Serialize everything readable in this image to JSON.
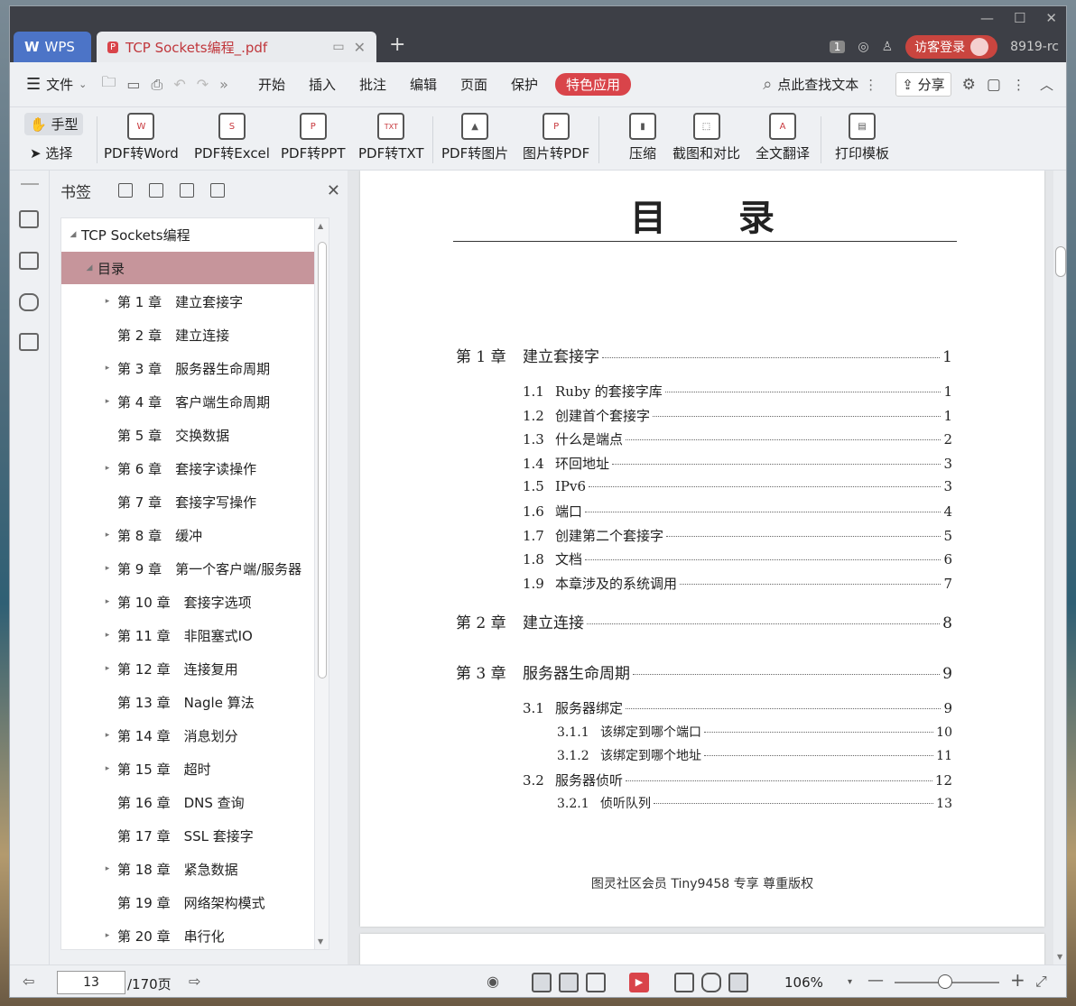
{
  "titlebar": {
    "wps_tab": "WPS",
    "doc_tab": "TCP Sockets编程_.pdf",
    "page_badge": "1",
    "login": "访客登录",
    "account": "8919-rc"
  },
  "menubar": {
    "file": "文件",
    "items": [
      "开始",
      "插入",
      "批注",
      "编辑",
      "页面",
      "保护"
    ],
    "feature": "特色应用",
    "search": "点此查找文本",
    "share": "分享"
  },
  "toolbar": {
    "hand": "手型",
    "select": "选择",
    "tools": [
      {
        "label": "PDF转Word",
        "ic": "W"
      },
      {
        "label": "PDF转Excel",
        "ic": "S"
      },
      {
        "label": "PDF转PPT",
        "ic": "P"
      },
      {
        "label": "PDF转TXT",
        "ic": "TXT"
      },
      {
        "label": "PDF转图片",
        "ic": "▲"
      },
      {
        "label": "图片转PDF",
        "ic": "P"
      },
      {
        "label": "压缩",
        "ic": "▮"
      },
      {
        "label": "截图和对比",
        "ic": "⬚"
      },
      {
        "label": "全文翻译",
        "ic": "A"
      },
      {
        "label": "打印模板",
        "ic": "▤"
      }
    ]
  },
  "bookmarks": {
    "title": "书签",
    "root": "TCP Sockets编程",
    "selected": "目录",
    "items": [
      {
        "label": "第 1 章　建立套接字",
        "expand": true
      },
      {
        "label": "第 2 章　建立连接",
        "expand": false
      },
      {
        "label": "第 3 章　服务器生命周期",
        "expand": true
      },
      {
        "label": "第 4 章　客户端生命周期",
        "expand": true
      },
      {
        "label": "第 5 章　交换数据",
        "expand": false
      },
      {
        "label": "第 6 章　套接字读操作",
        "expand": true
      },
      {
        "label": "第 7 章　套接字写操作",
        "expand": false
      },
      {
        "label": "第 8 章　缓冲",
        "expand": true
      },
      {
        "label": "第 9 章　第一个客户端/服务器",
        "expand": true
      },
      {
        "label": "第 10 章　套接字选项",
        "expand": true
      },
      {
        "label": "第 11 章　非阻塞式IO",
        "expand": true
      },
      {
        "label": "第 12 章　连接复用",
        "expand": true
      },
      {
        "label": "第 13 章　Nagle 算法",
        "expand": false
      },
      {
        "label": "第 14 章　消息划分",
        "expand": true
      },
      {
        "label": "第 15 章　超时",
        "expand": true
      },
      {
        "label": "第 16 章　DNS 查询",
        "expand": false
      },
      {
        "label": "第 17 章　SSL 套接字",
        "expand": false
      },
      {
        "label": "第 18 章　紧急数据",
        "expand": true
      },
      {
        "label": "第 19 章　网络架构模式",
        "expand": false
      },
      {
        "label": "第 20 章　串行化",
        "expand": true
      }
    ]
  },
  "document": {
    "title": "目录",
    "watermark": "图灵社区会员 Tiny9458 专享 尊重版权",
    "toc": [
      {
        "level": "ch",
        "num": "第 1 章",
        "text": "建立套接字",
        "page": "1"
      },
      {
        "level": "sec",
        "num": "1.1",
        "text": "Ruby 的套接字库",
        "page": "1"
      },
      {
        "level": "sec",
        "num": "1.2",
        "text": "创建首个套接字",
        "page": "1"
      },
      {
        "level": "sec",
        "num": "1.3",
        "text": "什么是端点",
        "page": "2"
      },
      {
        "level": "sec",
        "num": "1.4",
        "text": "环回地址",
        "page": "3"
      },
      {
        "level": "sec",
        "num": "1.5",
        "text": "IPv6",
        "page": "3"
      },
      {
        "level": "sec",
        "num": "1.6",
        "text": "端口",
        "page": "4"
      },
      {
        "level": "sec",
        "num": "1.7",
        "text": "创建第二个套接字",
        "page": "5"
      },
      {
        "level": "sec",
        "num": "1.8",
        "text": "文档",
        "page": "6"
      },
      {
        "level": "sec",
        "num": "1.9",
        "text": "本章涉及的系统调用",
        "page": "7"
      },
      {
        "level": "ch",
        "num": "第 2 章",
        "text": "建立连接",
        "page": "8"
      },
      {
        "level": "ch",
        "num": "第 3 章",
        "text": "服务器生命周期",
        "page": "9"
      },
      {
        "level": "sec",
        "num": "3.1",
        "text": "服务器绑定",
        "page": "9"
      },
      {
        "level": "sub",
        "num": "3.1.1",
        "text": "该绑定到哪个端口",
        "page": "10"
      },
      {
        "level": "sub",
        "num": "3.1.2",
        "text": "该绑定到哪个地址",
        "page": "11"
      },
      {
        "level": "sec",
        "num": "3.2",
        "text": "服务器侦听",
        "page": "12"
      },
      {
        "level": "sub",
        "num": "3.2.1",
        "text": "侦听队列",
        "page": "13"
      }
    ]
  },
  "statusbar": {
    "current_page": "13",
    "total_pages": "/170页",
    "zoom": "106%"
  }
}
